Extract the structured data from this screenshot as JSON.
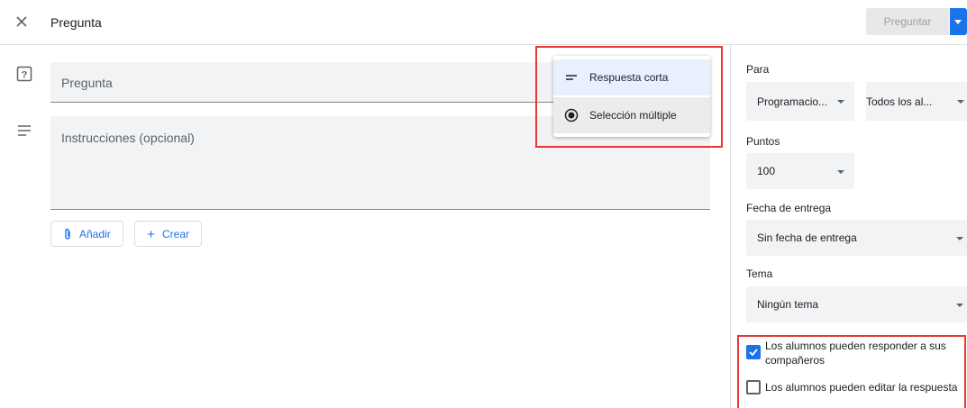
{
  "header": {
    "title": "Pregunta",
    "ask_label": "Preguntar"
  },
  "form": {
    "question_placeholder": "Pregunta",
    "instructions_placeholder": "Instrucciones (opcional)",
    "add_label": "Añadir",
    "create_label": "Crear"
  },
  "type_menu": {
    "items": [
      {
        "label": "Respuesta corta",
        "icon": "short-answer-icon",
        "selected": true
      },
      {
        "label": "Selección múltiple",
        "icon": "radio-icon",
        "selected": false
      }
    ]
  },
  "sidebar": {
    "for_label": "Para",
    "class_value": "Programacio...",
    "students_value": "Todos los al...",
    "points_label": "Puntos",
    "points_value": "100",
    "due_label": "Fecha de entrega",
    "due_value": "Sin fecha de entrega",
    "topic_label": "Tema",
    "topic_value": "Ningún tema",
    "reply_option": {
      "label": "Los alumnos pueden responder a sus compañeros",
      "checked": true
    },
    "edit_option": {
      "label": "Los alumnos pueden editar la respuesta",
      "checked": false
    }
  },
  "colors": {
    "accent": "#1a73e8",
    "highlight": "#e53935",
    "field_bg": "#f1f3f4"
  }
}
